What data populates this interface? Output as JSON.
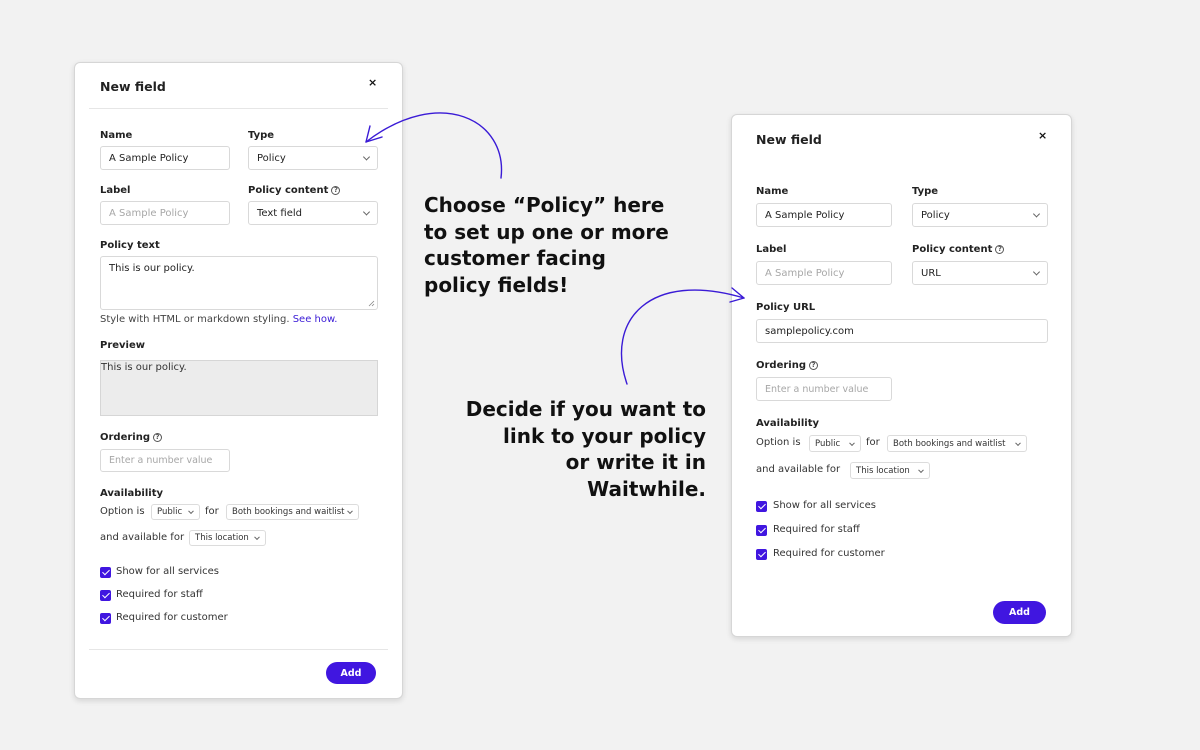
{
  "colors": {
    "accent": "#4016e0",
    "background": "#f2f2f2",
    "arrow": "#3a1bd6"
  },
  "left_dialog": {
    "title": "New field",
    "close_icon": "×",
    "name_label": "Name",
    "name_value": "A Sample Policy",
    "type_label": "Type",
    "type_value": "Policy",
    "label_label": "Label",
    "label_placeholder": "A Sample Policy",
    "policy_content_label": "Policy content",
    "policy_content_value": "Text field",
    "policy_text_label": "Policy text",
    "policy_text_value": "This is our policy.",
    "styling_hint": "Style with HTML or markdown styling.",
    "see_how_link": "See how.",
    "preview_label": "Preview",
    "preview_value": "This is our policy.",
    "ordering_label": "Ordering",
    "ordering_placeholder": "Enter a number value",
    "availability_label": "Availability",
    "option_is": "Option is",
    "option_value": "Public",
    "for_word": "for",
    "for_value": "Both bookings and waitlist",
    "available_for": "and available for",
    "location_value": "This location",
    "checkboxes": [
      "Show for all services",
      "Required for staff",
      "Required for customer"
    ],
    "add_button": "Add"
  },
  "right_dialog": {
    "title": "New field",
    "close_icon": "×",
    "name_label": "Name",
    "name_value": "A Sample Policy",
    "type_label": "Type",
    "type_value": "Policy",
    "label_label": "Label",
    "label_placeholder": "A Sample Policy",
    "policy_content_label": "Policy content",
    "policy_content_value": "URL",
    "policy_url_label": "Policy URL",
    "policy_url_value": "samplepolicy.com",
    "ordering_label": "Ordering",
    "ordering_placeholder": "Enter a number value",
    "availability_label": "Availability",
    "option_is": "Option is",
    "option_value": "Public",
    "for_word": "for",
    "for_value": "Both bookings and waitlist",
    "available_for": "and available for",
    "location_value": "This location",
    "checkboxes": [
      "Show for all services",
      "Required for staff",
      "Required for customer"
    ],
    "add_button": "Add"
  },
  "annotations": {
    "choose_policy": [
      "Choose “Policy” here",
      "to set up one or more",
      "customer facing",
      "policy fields!"
    ],
    "decide_link": [
      "Decide if you want to",
      "link to your policy",
      "or write it in Waitwhile."
    ]
  }
}
